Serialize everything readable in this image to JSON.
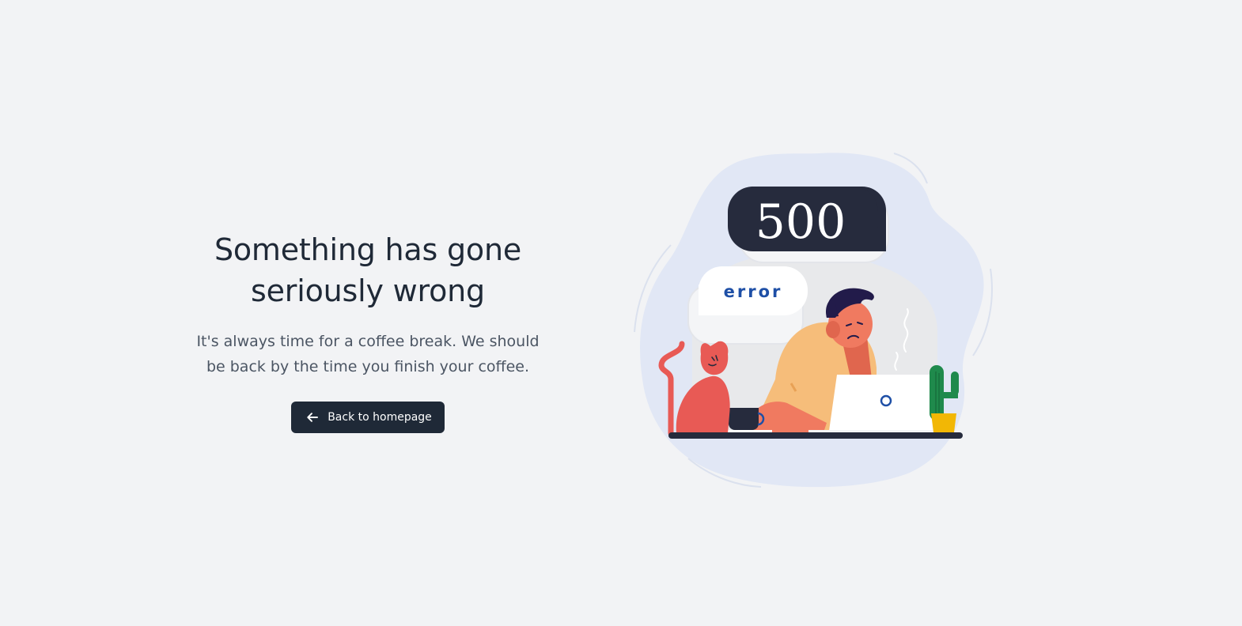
{
  "error_page": {
    "title_line1": "Something has gone",
    "title_line2": "seriously wrong",
    "message_line1": "It's always time for a coffee break. We should",
    "message_line2": "be back by the time you finish your coffee.",
    "back_button_label": "Back to homepage"
  },
  "illustration": {
    "code_bubble_text": "500",
    "error_bubble_text": "error",
    "icons": [
      "arrow-left-icon"
    ],
    "colors": {
      "background": "#f2f3f5",
      "button": "#1f2937",
      "blob": "#e1e7f5",
      "bubble_dark": "#262b3d",
      "error_text": "#1e4fa6",
      "skin": "#f07a60",
      "shirt": "#f6bd7a",
      "cat": "#e85a55",
      "cactus": "#1f8a4c",
      "pot": "#f2b705"
    }
  }
}
